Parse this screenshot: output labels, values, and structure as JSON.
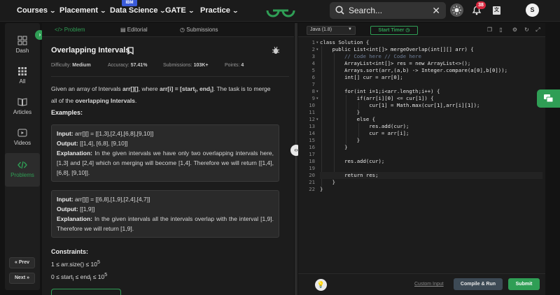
{
  "nav": {
    "courses": "Courses",
    "placement": "Placement",
    "data_science": "Data Science",
    "ibm_badge": "IBM",
    "gate": "GATE",
    "practice": "Practice",
    "search_placeholder": "Search...",
    "notification_count": "38",
    "avatar_initial": "S"
  },
  "sidebar": {
    "items": [
      {
        "label": "Dash",
        "icon": "grid-icon"
      },
      {
        "label": "All",
        "icon": "dots-grid-icon"
      },
      {
        "label": "Articles",
        "icon": "book-icon"
      },
      {
        "label": "Videos",
        "icon": "video-icon"
      },
      {
        "label": "Problems",
        "icon": "code-icon"
      }
    ],
    "prev_label": "« Prev",
    "next_label": "Next »"
  },
  "tabs": {
    "problem": "Problem",
    "editorial": "Editorial",
    "submissions": "Submissions"
  },
  "problem": {
    "title": "Overlapping Intervals",
    "difficulty_label": "Difficulty:",
    "difficulty": "Medium",
    "accuracy_label": "Accuracy:",
    "accuracy": "57.41%",
    "submissions_label": "Submissions:",
    "submissions": "103K+",
    "points_label": "Points:",
    "points": "4",
    "desc_1": "Given an array of Intervals ",
    "desc_arr": "arr[][]",
    "desc_2": ", where ",
    "desc_arr_i": "arr[i] = [start",
    "desc_i1": "i",
    "desc_mid": ", end",
    "desc_i2": "i",
    "desc_close": "]",
    "desc_3": ". The task is to merge all of the ",
    "desc_bold": "overlapping Intervals",
    "desc_4": ".",
    "examples_heading": "Examples:",
    "examples": [
      {
        "input_label": "Input:",
        "input": "arr[][]  =  [[1,3],[2,4],[6,8],[9,10]]",
        "output_label": "Output:",
        "output": "[[1,4],  [6,8],  [9,10]]",
        "explanation_label": "Explanation:",
        "explanation": "In the given intervals we have only two overlapping intervals here, [1,3] and [2,4] which on merging will become [1,4]. Therefore we will return [[1,4], [6,8], [9,10]]."
      },
      {
        "input_label": "Input:",
        "input": "arr[][]  =  [[6,8],[1,9],[2,4],[4,7]]",
        "output_label": "Output:",
        "output": "[[1,9]]",
        "explanation_label": "Explanation:",
        "explanation": "In the given intervals all the intervals overlap with the interval [1,9]. Therefore we will return [1,9]."
      }
    ],
    "constraints_heading": "Constraints:",
    "constraint_1_pre": "1 ≤ arr.size() ≤ 10",
    "constraint_1_exp": "5",
    "constraint_2_pre": "0 ≤ start",
    "constraint_2_sub1": "i",
    "constraint_2_mid": " ≤ end",
    "constraint_2_sub2": "i",
    "constraint_2_post": " ≤ 10",
    "constraint_2_exp": "5"
  },
  "editor": {
    "language": "Java (1.8)",
    "start_timer": "Start Timer",
    "custom_input": "Custom Input",
    "compile_run": "Compile & Run",
    "submit": "Submit",
    "lines": [
      {
        "n": "1",
        "text": "class Solution {",
        "fold": true,
        "indent": 0
      },
      {
        "n": "2",
        "text": "    public List<int[]> mergeOverlap(int[][] arr) {",
        "fold": true,
        "indent": 1
      },
      {
        "n": "3",
        "text": "        // Code here // Code here",
        "comment": true,
        "indent": 2
      },
      {
        "n": "4",
        "text": "        ArrayList<int[]> res = new ArrayList<>();",
        "indent": 2
      },
      {
        "n": "5",
        "text": "        Arrays.sort(arr,(a,b) -> Integer.compare(a[0],b[0]));",
        "indent": 2
      },
      {
        "n": "6",
        "text": "        int[] cur = arr[0];",
        "indent": 2
      },
      {
        "n": "7",
        "text": "",
        "indent": 2
      },
      {
        "n": "8",
        "text": "        for(int i=1;i<arr.length;i++) {",
        "fold": true,
        "indent": 2
      },
      {
        "n": "9",
        "text": "            if(arr[i][0] <= cur[1]) {",
        "fold": true,
        "indent": 3
      },
      {
        "n": "10",
        "text": "                cur[1] = Math.max(cur[1],arr[i][1]);",
        "indent": 4
      },
      {
        "n": "11",
        "text": "            }",
        "indent": 3
      },
      {
        "n": "12",
        "text": "            else {",
        "fold": true,
        "indent": 3
      },
      {
        "n": "13",
        "text": "                res.add(cur);",
        "indent": 4
      },
      {
        "n": "14",
        "text": "                cur = arr[i];",
        "indent": 4
      },
      {
        "n": "15",
        "text": "            }",
        "indent": 3
      },
      {
        "n": "16",
        "text": "        }",
        "indent": 2
      },
      {
        "n": "17",
        "text": "",
        "indent": 2
      },
      {
        "n": "18",
        "text": "        res.add(cur);",
        "indent": 2
      },
      {
        "n": "19",
        "text": "",
        "indent": 2
      },
      {
        "n": "20",
        "text": "        return res;",
        "indent": 2,
        "highlight": true
      },
      {
        "n": "21",
        "text": "    }",
        "indent": 1
      },
      {
        "n": "22",
        "text": "}",
        "indent": 0
      }
    ]
  },
  "colors": {
    "accent_green": "#2f9e55",
    "background": "#131313",
    "panel": "#1c1c1c",
    "badge_red": "#d6283f"
  }
}
